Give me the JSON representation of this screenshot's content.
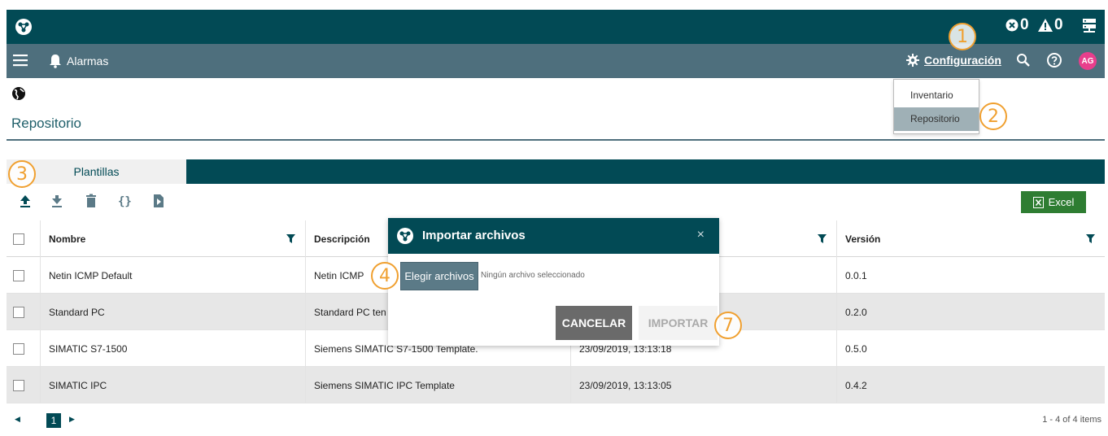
{
  "topbar": {
    "errors_count": "0",
    "warnings_count": "0"
  },
  "navbar": {
    "title": "Alarmas",
    "config_label": "Configuración",
    "avatar_initials": "AG"
  },
  "config_menu": {
    "items": [
      {
        "label": "Inventario",
        "active": false
      },
      {
        "label": "Repositorio",
        "active": true
      }
    ]
  },
  "page": {
    "title": "Repositorio"
  },
  "tabs": [
    {
      "label": "Plantillas"
    }
  ],
  "toolbar": {
    "excel_label": "Excel"
  },
  "table": {
    "columns": [
      "Nombre",
      "Descripción",
      "",
      "Versión"
    ],
    "rows": [
      {
        "name": "Netin ICMP Default",
        "description": "Netin ICMP",
        "date": "",
        "version": "0.0.1"
      },
      {
        "name": "Standard PC",
        "description": "Standard PC ten",
        "date": "",
        "version": "0.2.0"
      },
      {
        "name": "SIMATIC S7-1500",
        "description": "Siemens SIMATIC S7-1500 Template.",
        "date": "23/09/2019, 13:13:18",
        "version": "0.5.0"
      },
      {
        "name": "SIMATIC IPC",
        "description": "Siemens SIMATIC IPC Template",
        "date": "23/09/2019, 13:13:05",
        "version": "0.4.2"
      }
    ]
  },
  "pager": {
    "current_page": "1",
    "info": "1 - 4 of 4 items"
  },
  "modal": {
    "title": "Importar archivos",
    "close": "×",
    "choose_files": "Elegir archivos",
    "no_file": "Ningún archivo seleccionado",
    "cancel": "CANCELAR",
    "import": "IMPORTAR"
  },
  "markers": [
    "1",
    "2",
    "3",
    "4",
    "7"
  ],
  "colors": {
    "primary": "#024a55",
    "nav": "#4e6f7d",
    "accent": "#f0a030",
    "excel": "#2e7d32",
    "avatar": "#e83e8c"
  }
}
